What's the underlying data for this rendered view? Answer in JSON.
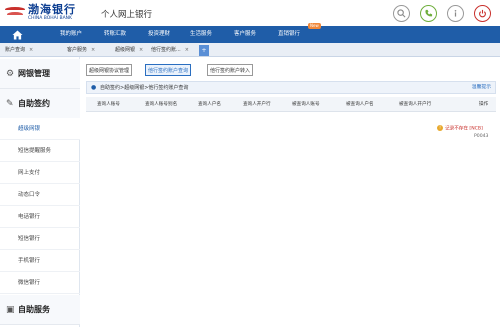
{
  "header": {
    "logo_cn": "渤海银行",
    "logo_en": "CHINA BOHAI BANK",
    "title": "个人网上银行",
    "icons": [
      "search-icon",
      "phone-icon",
      "info-icon",
      "power-icon"
    ]
  },
  "nav": {
    "items": [
      "我的账户",
      "转账汇款",
      "投资理财",
      "生活服务",
      "客户服务",
      "直销银行"
    ],
    "new_badge": "New"
  },
  "tabs": {
    "items": [
      "账户查询",
      "客户服务",
      "超级网银",
      "他行签约账..."
    ],
    "close": "×",
    "add": "+"
  },
  "sidebar": {
    "groups": [
      "网银管理",
      "自助签约",
      "自助服务"
    ],
    "items": [
      "超级网银",
      "短信提醒服务",
      "网上支付",
      "动态口令",
      "电话银行",
      "短信银行",
      "手机银行",
      "微信银行"
    ]
  },
  "subtabs": {
    "items": [
      "超级网银协议管理",
      "他行签约账户查询",
      "他行签约账户转入"
    ]
  },
  "breadcrumb": {
    "text": "自助签约>超级网银>他行签约账户查询",
    "tips": "温馨提示"
  },
  "table": {
    "headers": [
      "查询人账号",
      "查询人账号别名",
      "查询人户名",
      "查询人开户行",
      "被查询人账号",
      "被查询人户名",
      "被查询人开户行",
      "操作"
    ]
  },
  "error": {
    "message": "记录不存在 [NCB]",
    "code": "P0043"
  },
  "colors": {
    "nav_bg": "#1f5da8",
    "accent": "#2a6ec0",
    "error": "#c9302c"
  }
}
